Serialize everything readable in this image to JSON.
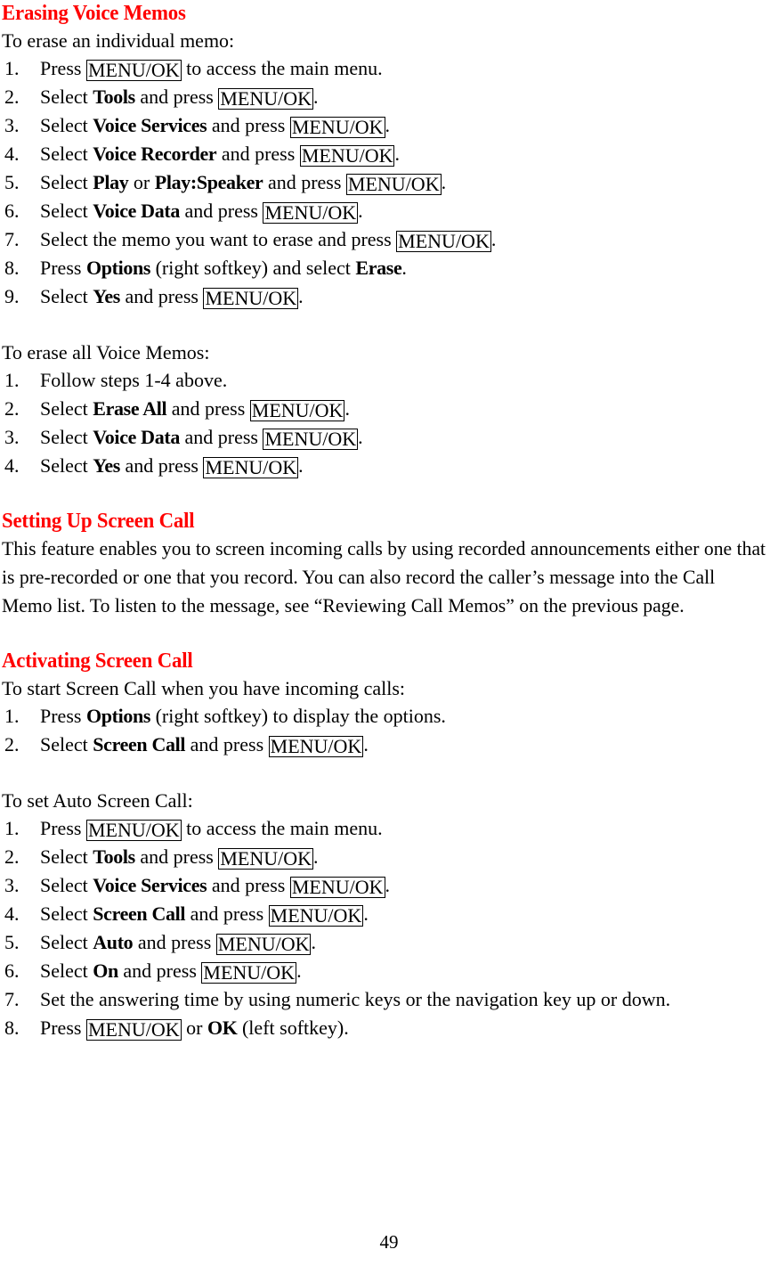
{
  "page": {
    "number": "49",
    "accent_color": "#ff0000",
    "text_color": "#000000",
    "background_color": "#ffffff"
  },
  "sections": {
    "erasing_voice_memos": {
      "heading": "Erasing Voice Memos",
      "intro_individual": "To erase an individual memo:",
      "steps_individual": [
        {
          "num": "1.",
          "parts": [
            {
              "t": "plain",
              "v": "Press "
            },
            {
              "t": "key",
              "v": "MENU/OK"
            },
            {
              "t": "plain",
              "v": " to access the main menu."
            }
          ]
        },
        {
          "num": "2.",
          "parts": [
            {
              "t": "plain",
              "v": "Select "
            },
            {
              "t": "bold",
              "v": "Tools"
            },
            {
              "t": "plain",
              "v": " and press "
            },
            {
              "t": "key",
              "v": "MENU/OK"
            },
            {
              "t": "plain",
              "v": "."
            }
          ]
        },
        {
          "num": "3.",
          "parts": [
            {
              "t": "plain",
              "v": "Select "
            },
            {
              "t": "bold",
              "v": "Voice Services"
            },
            {
              "t": "plain",
              "v": " and press "
            },
            {
              "t": "key",
              "v": "MENU/OK"
            },
            {
              "t": "plain",
              "v": "."
            }
          ]
        },
        {
          "num": "4.",
          "parts": [
            {
              "t": "plain",
              "v": "Select "
            },
            {
              "t": "bold",
              "v": "Voice Recorder"
            },
            {
              "t": "plain",
              "v": " and press "
            },
            {
              "t": "key",
              "v": "MENU/OK"
            },
            {
              "t": "plain",
              "v": "."
            }
          ]
        },
        {
          "num": "5.",
          "parts": [
            {
              "t": "plain",
              "v": "Select "
            },
            {
              "t": "bold",
              "v": "Play"
            },
            {
              "t": "plain",
              "v": " or "
            },
            {
              "t": "bold",
              "v": "Play:Speaker"
            },
            {
              "t": "plain",
              "v": " and press "
            },
            {
              "t": "key",
              "v": "MENU/OK"
            },
            {
              "t": "plain",
              "v": "."
            }
          ]
        },
        {
          "num": "6.",
          "parts": [
            {
              "t": "plain",
              "v": "Select "
            },
            {
              "t": "bold",
              "v": "Voice Data"
            },
            {
              "t": "plain",
              "v": " and press "
            },
            {
              "t": "key",
              "v": "MENU/OK"
            },
            {
              "t": "plain",
              "v": "."
            }
          ]
        },
        {
          "num": "7.",
          "parts": [
            {
              "t": "plain",
              "v": "Select the memo you want to erase and press "
            },
            {
              "t": "key",
              "v": "MENU/OK"
            },
            {
              "t": "plain",
              "v": "."
            }
          ]
        },
        {
          "num": "8.",
          "parts": [
            {
              "t": "plain",
              "v": "Press "
            },
            {
              "t": "bold",
              "v": "Options"
            },
            {
              "t": "plain",
              "v": " (right softkey) and select "
            },
            {
              "t": "bold",
              "v": "Erase"
            },
            {
              "t": "plain",
              "v": "."
            }
          ]
        },
        {
          "num": "9.",
          "parts": [
            {
              "t": "plain",
              "v": "Select "
            },
            {
              "t": "bold",
              "v": "Yes"
            },
            {
              "t": "plain",
              "v": " and press "
            },
            {
              "t": "key",
              "v": "MENU/OK"
            },
            {
              "t": "plain",
              "v": "."
            }
          ]
        }
      ],
      "intro_all": "To erase all Voice Memos:",
      "steps_all": [
        {
          "num": "1.",
          "parts": [
            {
              "t": "plain",
              "v": "Follow steps 1-4 above."
            }
          ]
        },
        {
          "num": "2.",
          "parts": [
            {
              "t": "plain",
              "v": "Select "
            },
            {
              "t": "bold",
              "v": "Erase All"
            },
            {
              "t": "plain",
              "v": " and press "
            },
            {
              "t": "key",
              "v": "MENU/OK"
            },
            {
              "t": "plain",
              "v": "."
            }
          ]
        },
        {
          "num": "3.",
          "parts": [
            {
              "t": "plain",
              "v": "Select "
            },
            {
              "t": "bold",
              "v": "Voice Data"
            },
            {
              "t": "plain",
              "v": " and press "
            },
            {
              "t": "key",
              "v": "MENU/OK"
            },
            {
              "t": "plain",
              "v": "."
            }
          ]
        },
        {
          "num": "4.",
          "parts": [
            {
              "t": "plain",
              "v": "Select "
            },
            {
              "t": "bold",
              "v": "Yes"
            },
            {
              "t": "plain",
              "v": " and press "
            },
            {
              "t": "key",
              "v": "MENU/OK"
            },
            {
              "t": "plain",
              "v": "."
            }
          ]
        }
      ]
    },
    "setting_up_screen_call": {
      "heading": "Setting Up Screen Call",
      "paragraph": "This feature enables you to screen incoming calls by using recorded announcements either one that is pre-recorded or one that you record. You can also record the caller’s message into the Call Memo list. To listen to the message, see “Reviewing Call Memos” on the previous page."
    },
    "activating_screen_call": {
      "heading": "Activating Screen Call",
      "intro_start": "To start Screen Call when you have incoming calls:",
      "steps_start": [
        {
          "num": "1.",
          "parts": [
            {
              "t": "plain",
              "v": "Press "
            },
            {
              "t": "bold",
              "v": "Options"
            },
            {
              "t": "plain",
              "v": " (right softkey) to display the options."
            }
          ]
        },
        {
          "num": "2.",
          "parts": [
            {
              "t": "plain",
              "v": "Select "
            },
            {
              "t": "bold",
              "v": "Screen Call"
            },
            {
              "t": "plain",
              "v": " and press "
            },
            {
              "t": "key",
              "v": "MENU/OK"
            },
            {
              "t": "plain",
              "v": "."
            }
          ]
        }
      ],
      "intro_auto": "To set Auto Screen Call:",
      "steps_auto": [
        {
          "num": "1.",
          "parts": [
            {
              "t": "plain",
              "v": "Press "
            },
            {
              "t": "key",
              "v": "MENU/OK"
            },
            {
              "t": "plain",
              "v": " to access the main menu."
            }
          ]
        },
        {
          "num": "2.",
          "parts": [
            {
              "t": "plain",
              "v": "Select "
            },
            {
              "t": "bold",
              "v": "Tools"
            },
            {
              "t": "plain",
              "v": " and press "
            },
            {
              "t": "key",
              "v": "MENU/OK"
            },
            {
              "t": "plain",
              "v": "."
            }
          ]
        },
        {
          "num": "3.",
          "parts": [
            {
              "t": "plain",
              "v": "Select "
            },
            {
              "t": "bold",
              "v": "Voice Services"
            },
            {
              "t": "plain",
              "v": " and press "
            },
            {
              "t": "key",
              "v": "MENU/OK"
            },
            {
              "t": "plain",
              "v": "."
            }
          ]
        },
        {
          "num": "4.",
          "parts": [
            {
              "t": "plain",
              "v": "Select "
            },
            {
              "t": "bold",
              "v": "Screen Call"
            },
            {
              "t": "plain",
              "v": " and press "
            },
            {
              "t": "key",
              "v": "MENU/OK"
            },
            {
              "t": "plain",
              "v": "."
            }
          ]
        },
        {
          "num": "5.",
          "parts": [
            {
              "t": "plain",
              "v": "Select "
            },
            {
              "t": "bold",
              "v": "Auto"
            },
            {
              "t": "plain",
              "v": " and press "
            },
            {
              "t": "key",
              "v": "MENU/OK"
            },
            {
              "t": "plain",
              "v": "."
            }
          ]
        },
        {
          "num": "6.",
          "parts": [
            {
              "t": "plain",
              "v": "Select "
            },
            {
              "t": "bold",
              "v": "On"
            },
            {
              "t": "plain",
              "v": " and press "
            },
            {
              "t": "key",
              "v": "MENU/OK"
            },
            {
              "t": "plain",
              "v": "."
            }
          ]
        },
        {
          "num": "7.",
          "parts": [
            {
              "t": "plain",
              "v": "Set the answering time by using numeric keys or the navigation key up or down."
            }
          ]
        },
        {
          "num": "8.",
          "parts": [
            {
              "t": "plain",
              "v": "Press "
            },
            {
              "t": "key",
              "v": "MENU/OK"
            },
            {
              "t": "plain",
              "v": " or "
            },
            {
              "t": "bold",
              "v": "OK"
            },
            {
              "t": "plain",
              "v": " (left softkey)."
            }
          ]
        }
      ]
    }
  }
}
